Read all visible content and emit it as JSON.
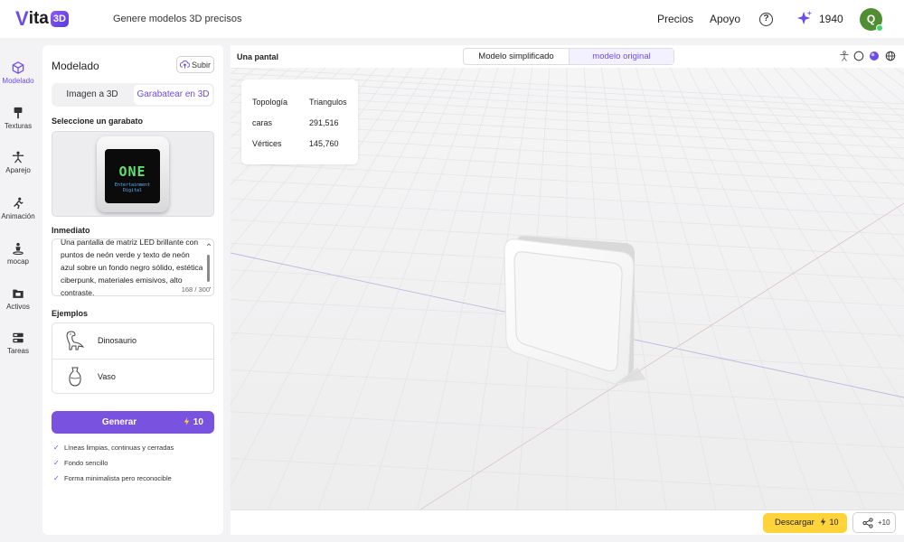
{
  "header": {
    "logo_v": "V",
    "logo_rest": "ita",
    "logo_badge": "3D",
    "tagline": "Genere modelos 3D precisos",
    "nav_pricing": "Precios",
    "nav_support": "Apoyo",
    "help_glyph": "?",
    "credits": "1940",
    "avatar_initial": "Q",
    "colors": {
      "accent": "#6d4ce4",
      "avatar_bg": "#4f8f32"
    }
  },
  "rail": {
    "items": [
      {
        "label": "Modelado",
        "icon": "cube-icon",
        "active": true
      },
      {
        "label": "Texturas",
        "icon": "brush-icon",
        "active": false
      },
      {
        "label": "Aparejo",
        "icon": "skeleton-icon",
        "active": false
      },
      {
        "label": "Animación",
        "icon": "running-figure-icon",
        "active": false
      },
      {
        "label": "mocap",
        "icon": "person-pin-icon",
        "active": false
      },
      {
        "label": "Activos",
        "icon": "folder-icon",
        "active": false
      },
      {
        "label": "Tareas",
        "icon": "task-list-icon",
        "active": false
      }
    ]
  },
  "panel": {
    "title": "Modelado",
    "upload_label": "Subir",
    "tabs": [
      {
        "label": "Imagen a 3D",
        "active": false
      },
      {
        "label": "Garabatear en 3D",
        "active": true
      }
    ],
    "sketch_label": "Seleccione un garabato",
    "sketch_preview": {
      "screen_text": "ONE",
      "screen_subtext": "Entertainment Digital"
    },
    "prompt_label": "Inmediato",
    "prompt_text": "Una pantalla de matriz LED brillante con puntos de neón verde y texto de neón azul sobre un fondo negro sólido, estética ciberpunk, materiales emisivos, alto contraste.",
    "prompt_counter": "168 / 300",
    "examples_label": "Ejemplos",
    "examples": [
      {
        "label": "Dinosaurio",
        "icon": "dinosaur-icon"
      },
      {
        "label": "Vaso",
        "icon": "vase-icon"
      }
    ],
    "generate_label": "Generar",
    "generate_cost": "10",
    "tips": [
      "Líneas limpias, continuas y cerradas",
      "Fondo sencillo",
      "Forma minimalista pero reconocible"
    ]
  },
  "viewer": {
    "model_name": "Una pantal",
    "modes": [
      {
        "label": "Modelo simplificado",
        "active": false
      },
      {
        "label": "modelo original",
        "active": true
      }
    ],
    "view_icons": [
      "figure-icon",
      "circle-icon",
      "sphere-icon",
      "globe-icon"
    ],
    "stats": {
      "header_key": "Topología",
      "header_val": "Triangulos",
      "rows": [
        {
          "key": "caras",
          "value": "291,516"
        },
        {
          "key": "Vértices",
          "value": "145,760"
        }
      ]
    },
    "download_label": "Descargar",
    "download_cost": "10",
    "share_label": "+10"
  }
}
